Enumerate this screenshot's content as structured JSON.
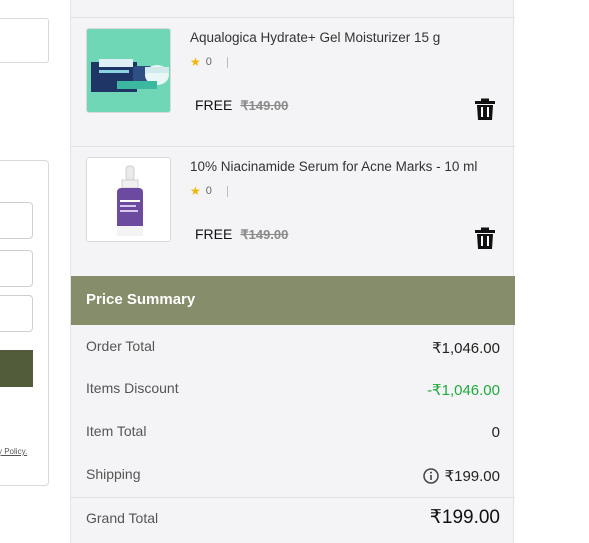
{
  "left_form": {
    "policy_text": "y Policy."
  },
  "cart": {
    "items": [
      {
        "name": "Aqualogica Hydrate+ Gel Moisturizer 15 g",
        "rating_count": "0",
        "price_label": "FREE",
        "original_price": "₹149.00",
        "thumb_text": "AQUALOGICA",
        "thumb_color": "#6fd6b6"
      },
      {
        "name": "10% Niacinamide Serum for Acne Marks - 10 ml",
        "rating_count": "0",
        "price_label": "FREE",
        "original_price": "₹149.00",
        "thumb_text": "thedermaco",
        "thumb_color": "#6b4aa0"
      }
    ]
  },
  "price_summary": {
    "title": "Price Summary",
    "header_color": "#858d6a",
    "rows": [
      {
        "label": "Order Total",
        "value": "₹1,046.00"
      },
      {
        "label": "Items Discount",
        "value": "-₹1,046.00"
      },
      {
        "label": "Item Total",
        "value": "0"
      },
      {
        "label": "Shipping",
        "value": "₹199.00"
      }
    ],
    "grand_total": {
      "label": "Grand Total",
      "value": "₹199.00"
    }
  }
}
